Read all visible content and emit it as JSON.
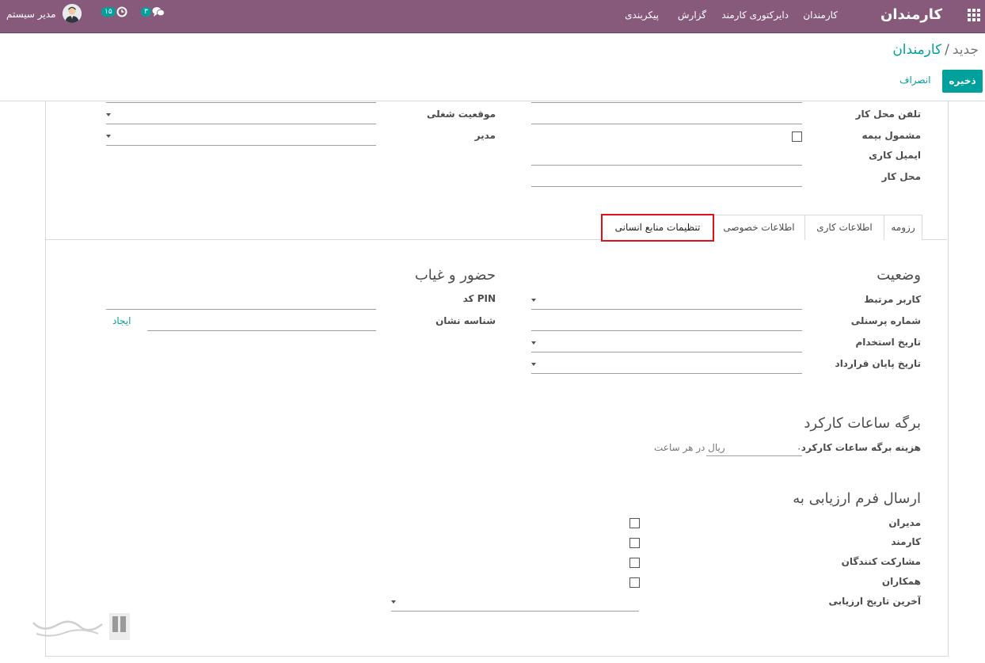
{
  "navbar": {
    "brand": "کارمندان",
    "menu": [
      "کارمندان",
      "دایرکتوری کارمند",
      "گزارش",
      "پیکربندی"
    ],
    "messages_count": "۳",
    "activities_count": "۱۵",
    "user_name": "مدیر سیستم",
    "icons": [
      "apps-icon",
      "chat-icon",
      "clock-icon",
      "user-avatar"
    ]
  },
  "breadcrumb": {
    "parent": "کارمندان",
    "separator": "/",
    "current": "جدید"
  },
  "buttons": {
    "save": "ذخیره",
    "discard": "انصراف"
  },
  "top_fields": {
    "work_phone": "تلفن محل کار",
    "insured": "مشمول بیمه",
    "work_email": "ایمیل کاری",
    "work_location": "محل کار",
    "job_position": "موقعیت شغلی",
    "manager": "مدیر"
  },
  "tabs": [
    {
      "label": "رزومه",
      "active": false
    },
    {
      "label": "اطلاعات کاری",
      "active": false
    },
    {
      "label": "اطلاعات خصوصی",
      "active": false
    },
    {
      "label": "تنظیمات منابع انسانی",
      "active": true
    }
  ],
  "status_section": {
    "title": "وضعیت",
    "related_user": "کاربر مرتبط",
    "employee_number": "شماره پرسنلی",
    "hire_date": "تاریخ استخدام",
    "contract_end": "تاریخ پایان قرارداد"
  },
  "attendance_section": {
    "title": "حضور و غیاب",
    "pin_code": "کد PIN",
    "badge_id": "شناسه نشان",
    "generate": "ایجاد"
  },
  "timesheet_section": {
    "title": "برگه ساعات کارکرد",
    "cost_label": "هزینه برگه ساعات کارکرد",
    "cost_value": "۰",
    "cost_unit": "ریال در هر ساعت"
  },
  "appraisal_section": {
    "title": "ارسال فرم ارزیابی به",
    "managers": "مدیران",
    "employee": "کارمند",
    "collaborators": "مشارکت کنندگان",
    "colleagues": "همکاران",
    "last_date": "آخرین تاریخ ارزیابی"
  },
  "watermark": "تیپ گستر"
}
